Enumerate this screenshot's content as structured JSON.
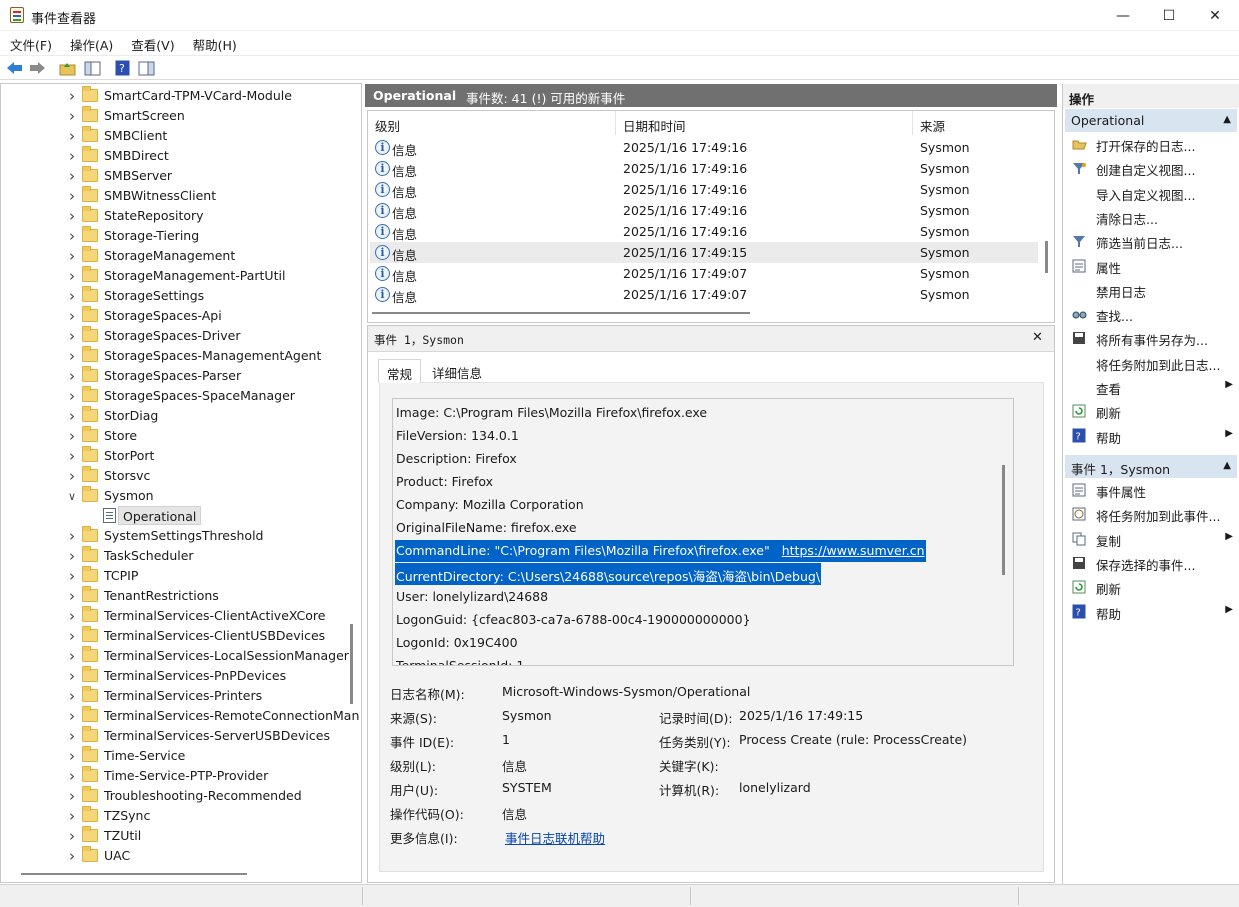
{
  "window": {
    "title": "事件查看器",
    "minimize": "—",
    "maximize": "☐",
    "close": "✕"
  },
  "menu": [
    "文件(F)",
    "操作(A)",
    "查看(V)",
    "帮助(H)"
  ],
  "tree": {
    "items": [
      "SmartCard-TPM-VCard-Module",
      "SmartScreen",
      "SMBClient",
      "SMBDirect",
      "SMBServer",
      "SMBWitnessClient",
      "StateRepository",
      "Storage-Tiering",
      "StorageManagement",
      "StorageManagement-PartUtil",
      "StorageSettings",
      "StorageSpaces-Api",
      "StorageSpaces-Driver",
      "StorageSpaces-ManagementAgent",
      "StorageSpaces-Parser",
      "StorageSpaces-SpaceManager",
      "StorDiag",
      "Store",
      "StorPort",
      "Storsvc",
      "Sysmon",
      "Operational",
      "SystemSettingsThreshold",
      "TaskScheduler",
      "TCPIP",
      "TenantRestrictions",
      "TerminalServices-ClientActiveXCore",
      "TerminalServices-ClientUSBDevices",
      "TerminalServices-LocalSessionManager",
      "TerminalServices-PnPDevices",
      "TerminalServices-Printers",
      "TerminalServices-RemoteConnectionMan",
      "TerminalServices-ServerUSBDevices",
      "Time-Service",
      "Time-Service-PTP-Provider",
      "Troubleshooting-Recommended",
      "TZSync",
      "TZUtil",
      "UAC"
    ]
  },
  "center": {
    "log_name": "Operational",
    "event_count": "事件数: 41 (!) 可用的新事件",
    "columns": [
      "级别",
      "日期和时间",
      "来源"
    ],
    "rows": [
      {
        "level": "信息",
        "datetime": "2025/1/16 17:49:16",
        "source": "Sysmon"
      },
      {
        "level": "信息",
        "datetime": "2025/1/16 17:49:16",
        "source": "Sysmon"
      },
      {
        "level": "信息",
        "datetime": "2025/1/16 17:49:16",
        "source": "Sysmon"
      },
      {
        "level": "信息",
        "datetime": "2025/1/16 17:49:16",
        "source": "Sysmon"
      },
      {
        "level": "信息",
        "datetime": "2025/1/16 17:49:16",
        "source": "Sysmon"
      },
      {
        "level": "信息",
        "datetime": "2025/1/16 17:49:15",
        "source": "Sysmon"
      },
      {
        "level": "信息",
        "datetime": "2025/1/16 17:49:07",
        "source": "Sysmon"
      },
      {
        "level": "信息",
        "datetime": "2025/1/16 17:49:07",
        "source": "Sysmon"
      }
    ]
  },
  "detail": {
    "title": "事件 1，Sysmon",
    "close": "✕",
    "tabs": [
      "常规",
      "详细信息"
    ],
    "lines": [
      "Image: C:\\Program Files\\Mozilla Firefox\\firefox.exe",
      "FileVersion: 134.0.1",
      "Description: Firefox",
      "Product: Firefox",
      "Company: Mozilla Corporation",
      "OriginalFileName: firefox.exe",
      "CommandLine: \"C:\\Program Files\\Mozilla Firefox\\firefox.exe\"",
      "CurrentDirectory: C:\\Users\\24688\\source\\repos\\海盗\\海盗\\bin\\Debug\\",
      "User: lonelylizard\\24688",
      "LogonGuid: {cfeac803-ca7a-6788-00c4-190000000000}",
      "LogonId: 0x19C400",
      "TerminalSessionId: 1"
    ],
    "link": "https://www.sumver.cn",
    "meta": {
      "log_name_label": "日志名称(M):",
      "log_name": "Microsoft-Windows-Sysmon/Operational",
      "source_label": "来源(S):",
      "source": "Sysmon",
      "logged_label": "记录时间(D):",
      "logged": "2025/1/16 17:49:15",
      "event_id_label": "事件 ID(E):",
      "event_id": "1",
      "task_label": "任务类别(Y):",
      "task": "Process Create (rule: ProcessCreate)",
      "level_label": "级别(L):",
      "level": "信息",
      "keywords_label": "关键字(K):",
      "keywords": "",
      "user_label": "用户(U):",
      "user": "SYSTEM",
      "computer_label": "计算机(R):",
      "computer": "lonelylizard",
      "opcode_label": "操作代码(O):",
      "opcode": "信息",
      "more_label": "更多信息(I):",
      "more_link": "事件日志联机帮助"
    }
  },
  "actions": {
    "title": "操作",
    "section1": "Operational",
    "items1": [
      "打开保存的日志...",
      "创建自定义视图...",
      "导入自定义视图...",
      "清除日志...",
      "筛选当前日志...",
      "属性",
      "禁用日志",
      "查找...",
      "将所有事件另存为...",
      "将任务附加到此日志...",
      "查看",
      "刷新",
      "帮助"
    ],
    "section2": "事件 1，Sysmon",
    "items2": [
      "事件属性",
      "将任务附加到此事件...",
      "复制",
      "保存选择的事件...",
      "刷新",
      "帮助"
    ]
  },
  "colors": {
    "selection": "#0063c8",
    "header": "#707070",
    "section": "#d9e4f1"
  }
}
